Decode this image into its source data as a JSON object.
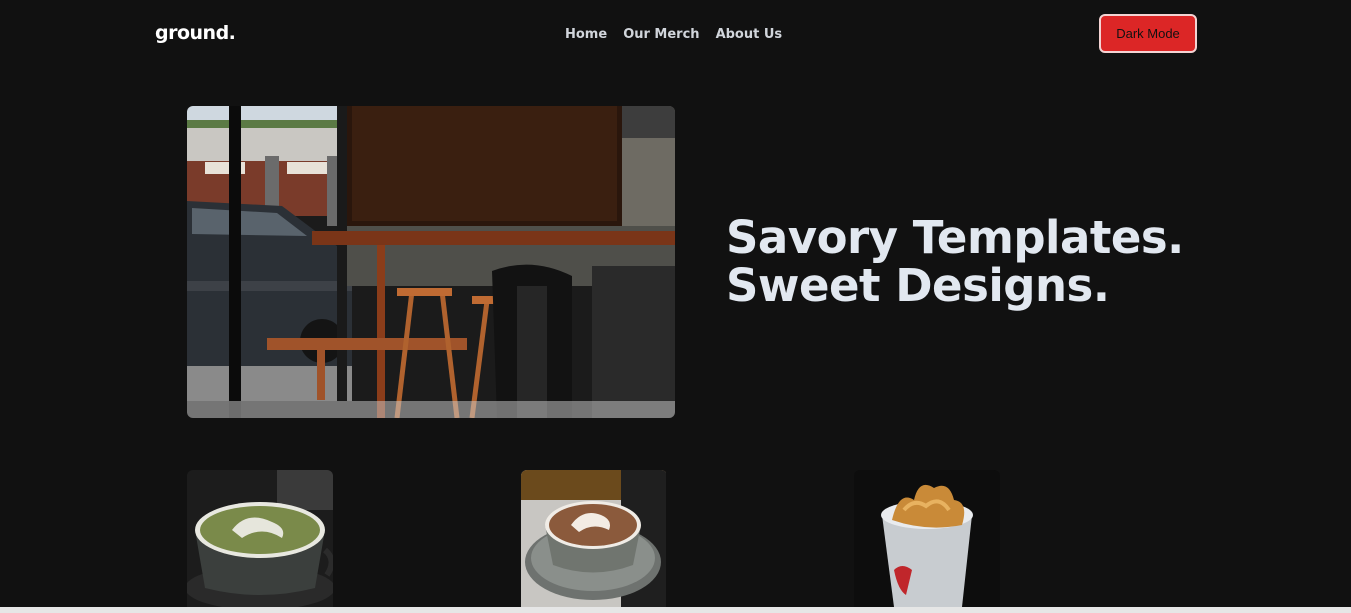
{
  "brand": {
    "logo": "ground."
  },
  "nav": {
    "links": [
      "Home",
      "Our Merch",
      "About Us"
    ],
    "theme_button": "Dark Mode"
  },
  "hero": {
    "title_line1": "Savory Templates.",
    "title_line2": "Sweet Designs.",
    "image_subject": "cafe-interior-photo"
  },
  "products": [
    {
      "image_subject": "matcha-latte-photo"
    },
    {
      "image_subject": "cappuccino-photo"
    },
    {
      "image_subject": "pastry-cup-photo"
    }
  ],
  "colors": {
    "background": "#111111",
    "accent": "#dc2626",
    "heading": "#e2e8f0",
    "nav_text": "#d1d5db"
  }
}
